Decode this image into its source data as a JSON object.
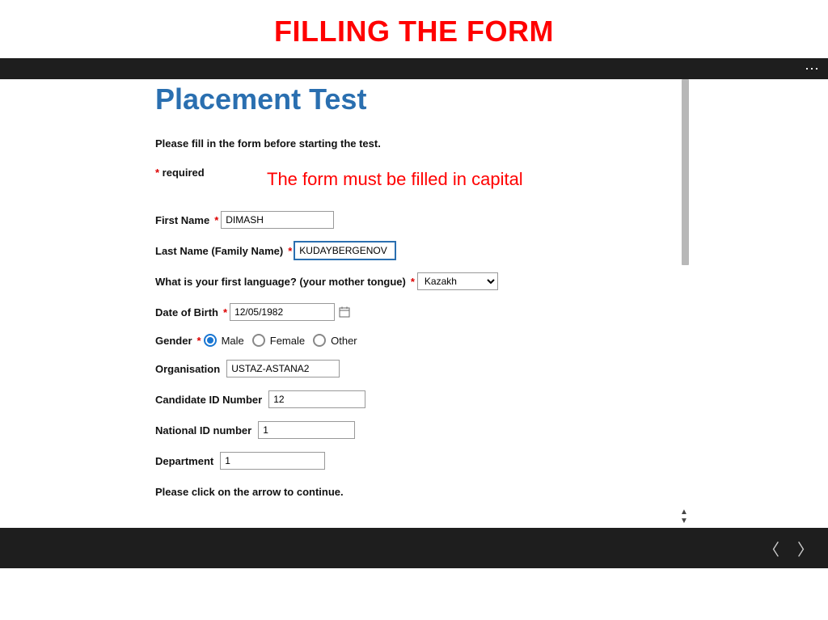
{
  "slide": {
    "title": "FILLING THE FORM"
  },
  "form": {
    "heading": "Placement Test",
    "instruction": "Please fill in the form before starting the test.",
    "required_label": "required",
    "annotation": "The form must be filled in capital",
    "continue_text": "Please click on the arrow to continue.",
    "fields": {
      "first_name": {
        "label": "First Name",
        "value": "DIMASH"
      },
      "last_name": {
        "label": "Last Name (Family Name)",
        "value": "KUDAYBERGENOV"
      },
      "language": {
        "label": "What is your first language? (your mother tongue)",
        "value": "Kazakh"
      },
      "dob": {
        "label": "Date of Birth",
        "value": "12/05/1982"
      },
      "gender": {
        "label": "Gender",
        "options": [
          "Male",
          "Female",
          "Other"
        ],
        "selected": "Male"
      },
      "organisation": {
        "label": "Organisation",
        "value": "USTAZ-ASTANA2"
      },
      "candidate_id": {
        "label": "Candidate ID Number",
        "value": "12"
      },
      "national_id": {
        "label": "National ID number",
        "value": "1"
      },
      "department": {
        "label": "Department",
        "value": "1"
      }
    }
  }
}
